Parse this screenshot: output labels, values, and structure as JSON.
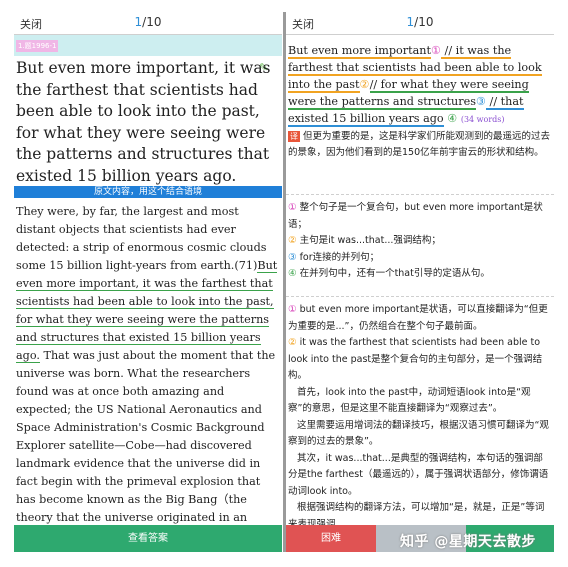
{
  "left": {
    "close_label": "关闭",
    "page_current": "1",
    "page_total": "/10",
    "tag": "1.题1996-1",
    "question": "But even more important, it was the farthest that scientists had been able to look into the past, for what they were seeing were the patterns and structures that existed 15 billion years ago.",
    "section_label": "原文内容，用这个结合语境",
    "passage_before": "They were, by far, the largest and most distant objects that scientists had ever detected: a strip of enormous cosmic clouds some 15 billion light-years from earth.(71)",
    "passage_highlight": "But even more important, it was the farthest that scientists had been able to look into the past, for what they were seeing were the patterns and structures that existed 15 billion years ago.",
    "passage_after": " That was just about the moment that the universe was born. What the researchers found was at once both amazing and expected; the US National Aeronautics and Space Administration's Cosmic Background Explorer satellite—Cobe—had discovered landmark evidence that the universe did in fact begin with the primeval explosion that has become known as the Big Bang（the theory that the universe originated in an explosion from a single mass of energy）.",
    "button_label": "查看答案"
  },
  "right": {
    "close_label": "关闭",
    "page_current": "1",
    "page_total": "/10",
    "seg1": "But even more important",
    "mark1": "①",
    "seg2": " // it was the farthest that scientists had been able to look into the past",
    "mark2": "②",
    "seg3": "// for what they were seeing were the patterns and structures",
    "mark3": "③",
    "seg4": " // that existed 15 billion years ago",
    "mark4": "④",
    "words": "(34 words)",
    "yi": "译",
    "translation": "但更为重要的是，这是科学家们所能观测到的最遥远的过去的景象，因为他们看到的是150亿年前宇宙云的形状和结构。",
    "points": [
      {
        "num": "①",
        "text": "整个句子是一个复合句，but even more important是状语；"
      },
      {
        "num": "②",
        "text": "主句是it was...that...强调结构；"
      },
      {
        "num": "③",
        "text": "for连接的并列句；"
      },
      {
        "num": "④",
        "text": "在并列句中，还有一个that引导的定语从句。"
      }
    ],
    "exp1_num": "①",
    "exp1": "but even more important是状语，可以直接翻译为“但更为重要的是...”，仍然组合在整个句子最前面。",
    "exp2_num": "②",
    "exp2": "it was the farthest that scientists had been able to look into the past是整个复合句的主句部分，是一个强调结构。",
    "exp3": "首先，look into the past中，动词短语look into是“观察”的意思，但是这里不能直接翻译为“观察过去”。",
    "exp4": "这里需要运用增词法的翻译技巧，根据汉语习惯可翻译为“观察到的过去的景象”。",
    "exp5": "其次，it was...that...是典型的强调结构，本句话的强调部分是the farthest（最遥远的），属于强调状语部分，修饰谓语动词look into。",
    "exp6": "根据强调结构的翻译方法，可以增加“是，就是，正是”等词来表现强调",
    "btn_hard": "困难",
    "btn_mid": "",
    "btn_easy": ""
  },
  "watermark": "知乎 @星期天去散步"
}
